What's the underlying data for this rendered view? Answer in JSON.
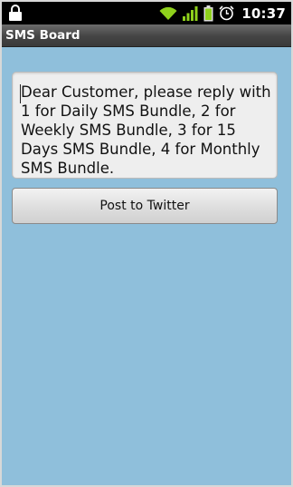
{
  "status_bar": {
    "time": "10:37",
    "icons": [
      "lock-icon",
      "wifi-icon",
      "signal-icon",
      "battery-icon",
      "alarm-icon"
    ]
  },
  "app": {
    "title": "SMS Board"
  },
  "message": {
    "text": "Dear Customer, please reply with 1 for Daily SMS Bundle, 2 for Weekly SMS Bundle, 3 for 15 Days SMS Bundle, 4 for Monthly SMS Bundle."
  },
  "actions": {
    "post_label": "Post to Twitter"
  },
  "colors": {
    "background": "#8fbfdb",
    "status_green": "#8fd11c"
  }
}
